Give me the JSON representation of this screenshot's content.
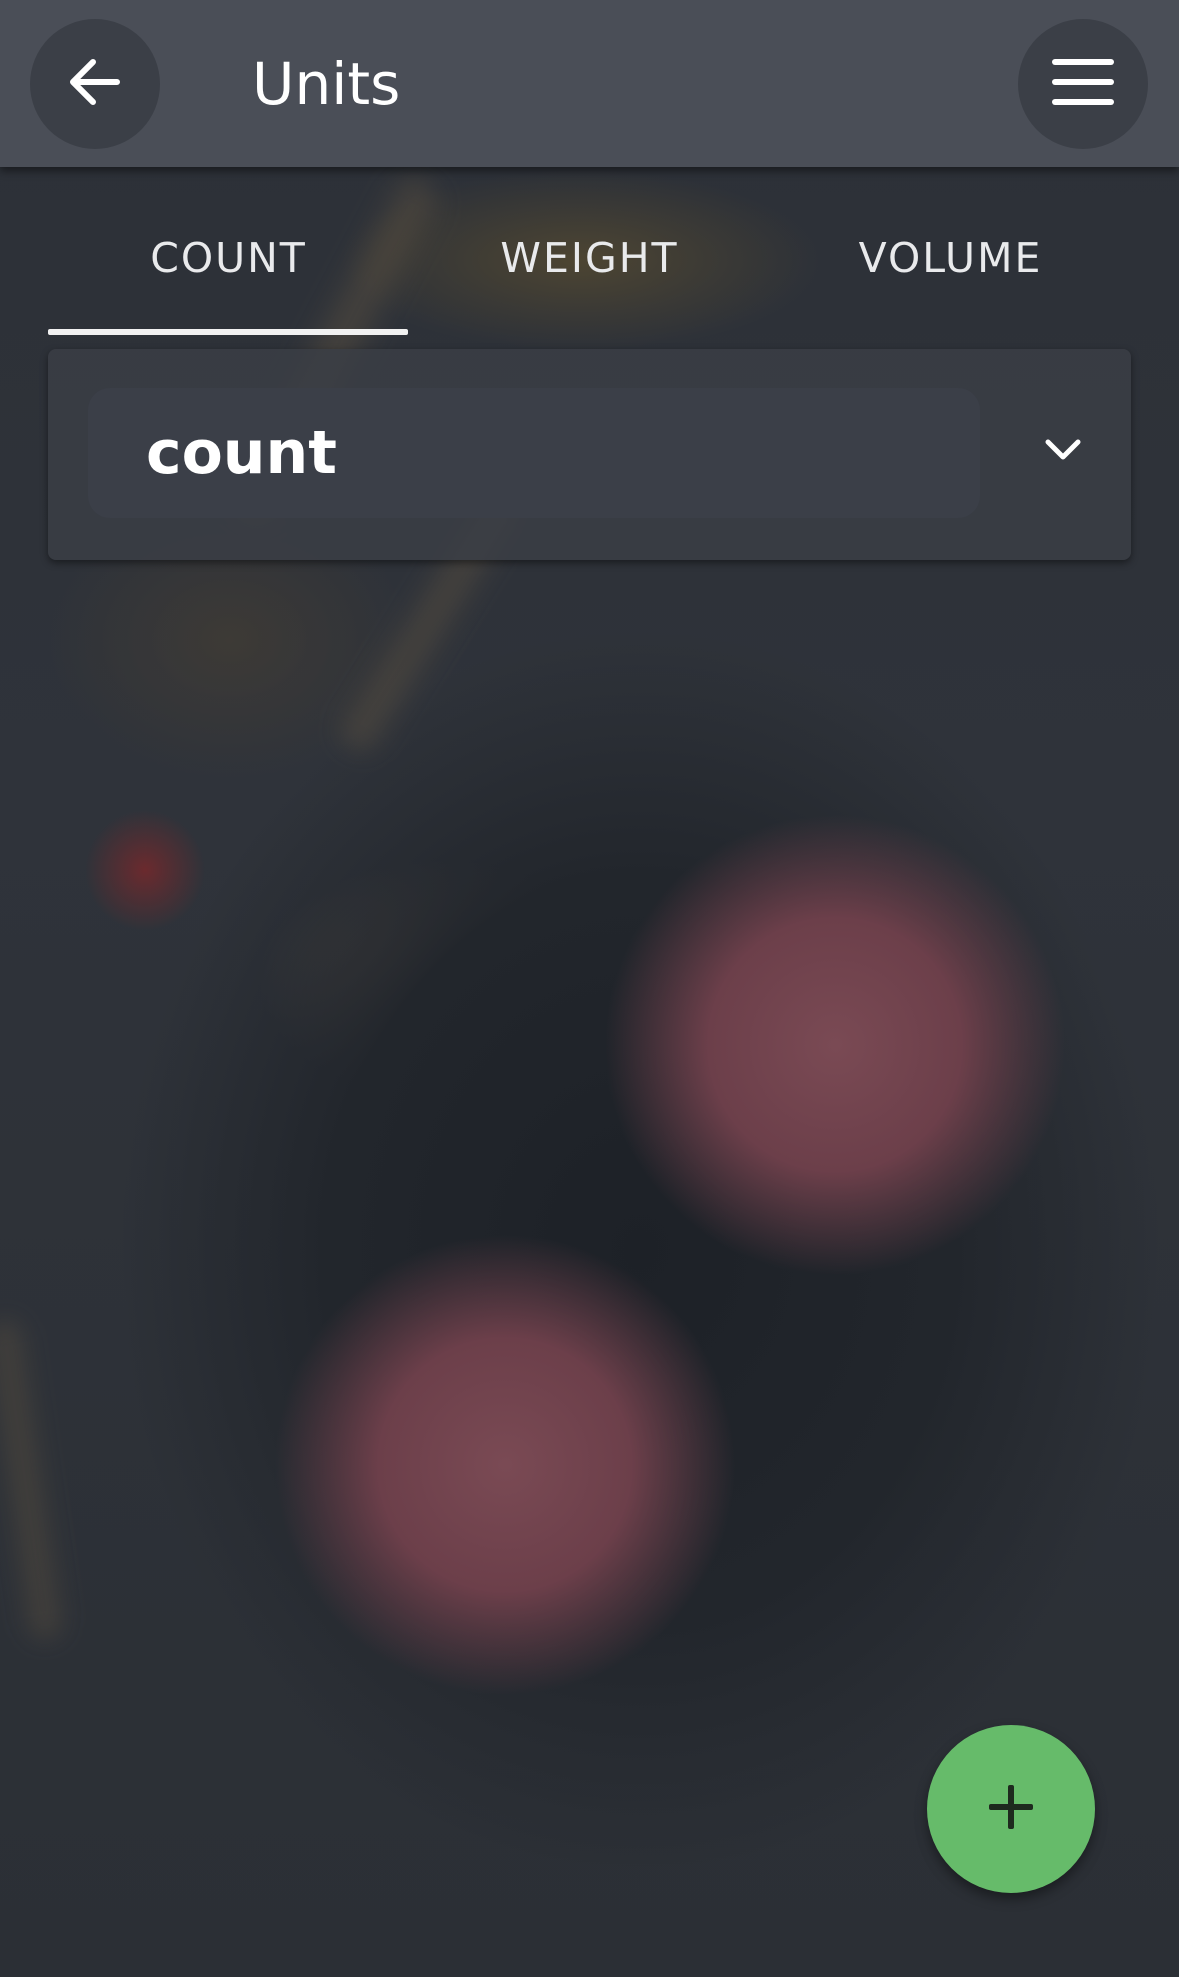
{
  "header": {
    "title": "Units",
    "back_icon": "arrow-left-icon",
    "menu_icon": "hamburger-menu-icon"
  },
  "tabs": [
    {
      "label": "COUNT",
      "selected": true
    },
    {
      "label": "WEIGHT",
      "selected": false
    },
    {
      "label": "VOLUME",
      "selected": false
    }
  ],
  "unit_select": {
    "value": "count",
    "toggle_icon": "chevron-down-icon"
  },
  "fab": {
    "icon": "plus-icon",
    "color": "#66bb6a"
  },
  "colors": {
    "app_bar": "#4a4e57",
    "icon_button": "#3b3f47",
    "panel": "#3a3e46",
    "field": "#3b3f48",
    "text": "#ffffff"
  }
}
